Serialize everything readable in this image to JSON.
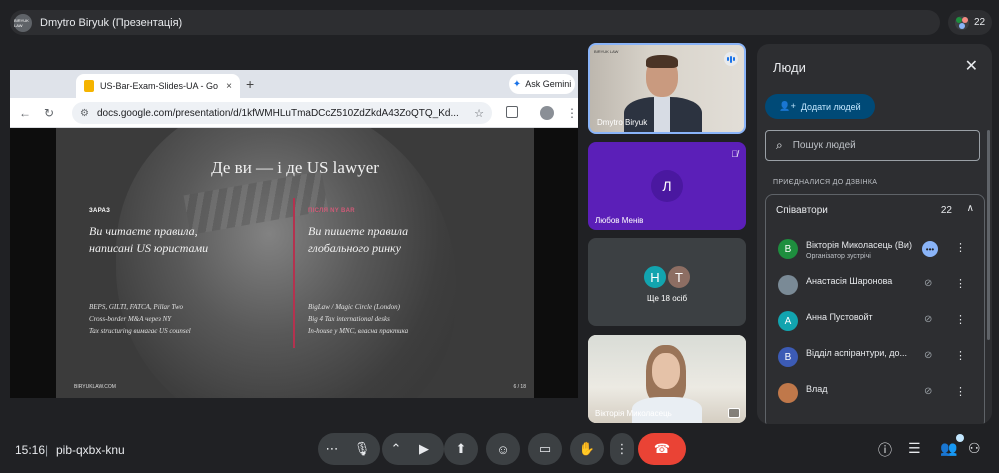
{
  "topbar": {
    "presentation_title": "Dmytro Biryuk (Презентація)",
    "participant_count": "22",
    "thumb_text": "BIRYUK LAW"
  },
  "browser": {
    "tab_title": "US-Bar-Exam-Slides-UA - Go",
    "tab_close": "×",
    "new_tab": "+",
    "gemini_label": "Ask Gemini",
    "url": "docs.google.com/presentation/d/1kfWMHLuTmaDCcZ510ZdZkdA43ZoQTQ_Kd..."
  },
  "slide": {
    "title": "Де ви — і де US lawyer",
    "left": {
      "label": "ЗАРАЗ",
      "heading_1": "Ви читаєте правила,",
      "heading_2": "написані US юристами",
      "items": [
        "BEPS, GILTI, FATCA, Pillar Two",
        "Cross-border M&A через NY",
        "Tax structuring вимагає US counsel"
      ]
    },
    "right": {
      "label": "ПІСЛЯ NY BAR",
      "heading_1": "Ви пишете правила",
      "heading_2": "глобального ринку",
      "items": [
        "BigLaw / Magic Circle (London)",
        "Big 4 Tax international desks",
        "In-house у MNC, власна практика"
      ]
    },
    "footer": "BIRYUKLAW.COM",
    "page": "6 / 18",
    "accent_color": "#b4324f"
  },
  "tiles": {
    "presenter": {
      "name": "Dmytro Biryuk",
      "logo": "BIRYUK LAW"
    },
    "tile2": {
      "initial": "Л",
      "name": "Любов Менів",
      "color": "#5b1fb8"
    },
    "tile3": {
      "initial_1": "Н",
      "initial_2": "Т",
      "label": "Ще 18 осіб"
    },
    "tile4": {
      "name": "Вікторія Миколасець"
    }
  },
  "people_panel": {
    "title": "Люди",
    "add_label": "Додати людей",
    "search_placeholder": "Пошук людей",
    "joined_label": "ПРИЄДНАЛИСЯ ДО ДЗВІНКА",
    "group_label": "Співавтори",
    "group_count": "22",
    "persons": [
      {
        "initial": "В",
        "name": "Вікторія Миколасець (Ви)",
        "sub": "Організатор зустрічі",
        "color": "#1e8e3e"
      },
      {
        "initial": "",
        "name": "Анастасія Шаронова",
        "sub": "",
        "color": "#7a8a96"
      },
      {
        "initial": "А",
        "name": "Анна Пустовойт",
        "sub": "",
        "color": "#12a4af"
      },
      {
        "initial": "В",
        "name": "Відділ аспірантури, до...",
        "sub": "",
        "color": "#3c5bb5"
      },
      {
        "initial": "",
        "name": "Влад",
        "sub": "",
        "color": "#c0784a"
      }
    ]
  },
  "bottom_bar": {
    "time": "15:16",
    "separator": "|",
    "meeting_code": "pib-qxbx-knu"
  },
  "colors": {
    "background": "#202124",
    "hangup": "#ea4335",
    "presenter_border": "#8ab4f8"
  }
}
